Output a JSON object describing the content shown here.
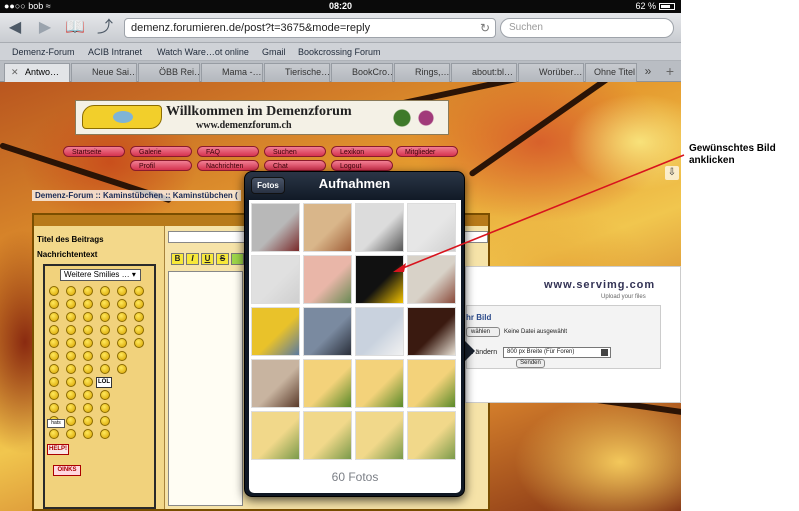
{
  "status_bar": {
    "carrier": "bob",
    "time": "08:20",
    "battery": "62 %"
  },
  "browser": {
    "url": "demenz.forumieren.de/post?t=3675&mode=reply",
    "search_placeholder": "Suchen",
    "bookmarks": [
      "Demenz-Forum",
      "ACIB Intranet",
      "Watch Ware…ot online",
      "Gmail",
      "Bookcrossing Forum"
    ],
    "tabs": [
      "Antwo…",
      "Neue Sai…",
      "ÖBB Rei…",
      "Mama -…",
      "Tierische…",
      "BookCro…",
      "Rings,…",
      "about:bl…",
      "Worüber…",
      "Ohne Titel"
    ]
  },
  "forum": {
    "banner_title": "Willkommen im Demenzforum",
    "banner_url": "www.demenzforum.ch",
    "nav": [
      "Startseite",
      "Galerie",
      "FAQ",
      "Suchen",
      "Lexikon",
      "Mitglieder",
      "Profil",
      "Nachrichten",
      "Chat",
      "Logout"
    ],
    "breadcrumb": "Demenz-Forum :: Kaminstübchen :: Kaminstübchen (",
    "header_partial": "Antw",
    "subject_label": "Titel des Beitrags",
    "message_label": "Nachrichtentext",
    "smiley_select": "Weitere Smilies …",
    "format_buttons": [
      "B",
      "I",
      "U",
      "S"
    ],
    "smiley_tags": [
      "LOL",
      "HELP!",
      "OINKS",
      "hats"
    ]
  },
  "upload_dialog": {
    "brand": "www.servimg.com",
    "brand_sub": "Upload your files",
    "title": "hr Bild",
    "file_button": "wählen",
    "file_text": "Keine Datei ausgewählt",
    "size_label": "es ändern",
    "size_value": "800 px Breite (Für Foren)",
    "send_button": "Senden"
  },
  "photo_picker": {
    "back_button": "Fotos",
    "title": "Aufnahmen",
    "count": "60 Fotos",
    "thumbs": [
      {
        "name": "keyboard-screenshot",
        "c1": "#b8b8b8",
        "c2": "#7a2a2a"
      },
      {
        "name": "man-with-hat",
        "c1": "#d9b68a",
        "c2": "#a0603a"
      },
      {
        "name": "couple-umbrella-bw",
        "c1": "#dcdcdc",
        "c2": "#555555"
      },
      {
        "name": "blank",
        "c1": "#e6e6e6",
        "c2": "#d0d0d0"
      },
      {
        "name": "blank",
        "c1": "#e0e0e0",
        "c2": "#cfcfcf"
      },
      {
        "name": "pig",
        "c1": "#e9b6a8",
        "c2": "#6a8a55"
      },
      {
        "name": "smiley-logo-black",
        "c1": "#111111",
        "c2": "#f2c200"
      },
      {
        "name": "old-man",
        "c1": "#d8d2c8",
        "c2": "#8a4a3a"
      },
      {
        "name": "yellow-car",
        "c1": "#e9c22a",
        "c2": "#5a7aa0"
      },
      {
        "name": "laptop-screen",
        "c1": "#7a8aa0",
        "c2": "#2a2f3a"
      },
      {
        "name": "dialog-screenshot",
        "c1": "#c9d2de",
        "c2": "#f2f2f2"
      },
      {
        "name": "cup-dessert",
        "c1": "#3a1a10",
        "c2": "#e9e2d6"
      },
      {
        "name": "baby-cake",
        "c1": "#c8b4a0",
        "c2": "#5a3a2a"
      },
      {
        "name": "forum-screenshot",
        "c1": "#f3d27a",
        "c2": "#5a8a2a"
      },
      {
        "name": "forum-screenshot",
        "c1": "#f3d27a",
        "c2": "#5a8a2a"
      },
      {
        "name": "forum-screenshot",
        "c1": "#f3d27a",
        "c2": "#5a8a2a"
      },
      {
        "name": "forum-screenshot",
        "c1": "#f1d88a",
        "c2": "#7a9a4a"
      },
      {
        "name": "forum-screenshot",
        "c1": "#f1d88a",
        "c2": "#7a9a4a"
      },
      {
        "name": "forum-screenshot",
        "c1": "#f1d88a",
        "c2": "#7a9a4a"
      },
      {
        "name": "forum-screenshot",
        "c1": "#f1d88a",
        "c2": "#7a9a4a"
      }
    ]
  },
  "annotation": {
    "line1": "Gewünschtes Bild",
    "line2": "anklicken",
    "color": "#d8141e"
  }
}
